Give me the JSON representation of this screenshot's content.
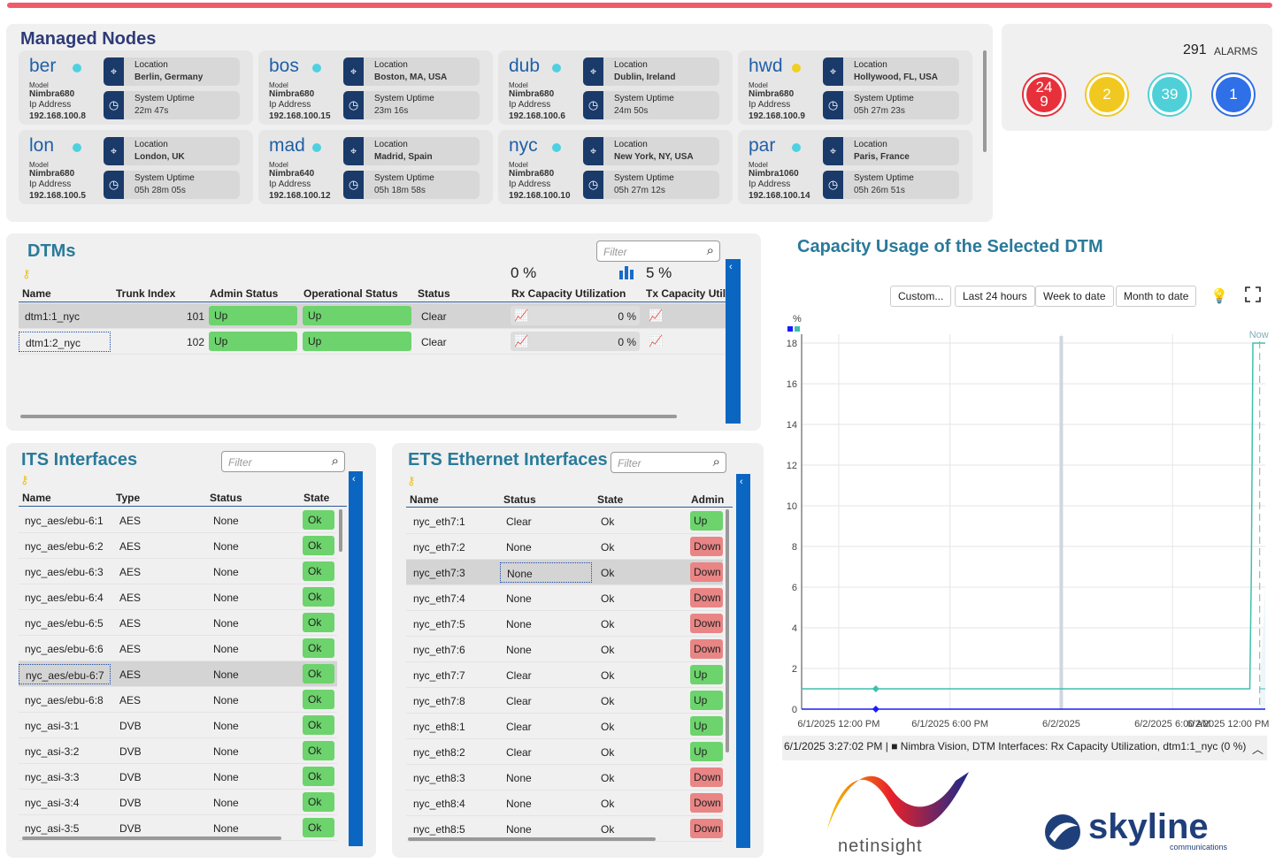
{
  "nodes_panel": {
    "title": "Managed Nodes",
    "nodes": [
      {
        "name": "ber",
        "dot": "#4fd0e0",
        "model_label": "Model",
        "model": "Nimbra680",
        "ip_label": "Ip Address",
        "ip": "192.168.100.8",
        "loc_label": "Location",
        "location": "Berlin, Germany",
        "up_label": "System Uptime",
        "uptime": "22m 47s"
      },
      {
        "name": "bos",
        "dot": "#4fd0e0",
        "model_label": "Model",
        "model": "Nimbra680",
        "ip_label": "Ip Address",
        "ip": "192.168.100.15",
        "loc_label": "Location",
        "location": "Boston, MA, USA",
        "up_label": "System Uptime",
        "uptime": "23m 16s"
      },
      {
        "name": "dub",
        "dot": "#4fd0e0",
        "model_label": "Model",
        "model": "Nimbra680",
        "ip_label": "Ip Address",
        "ip": "192.168.100.6",
        "loc_label": "Location",
        "location": "Dublin, Ireland",
        "up_label": "System Uptime",
        "uptime": "24m 50s"
      },
      {
        "name": "hwd",
        "dot": "#f0d020",
        "model_label": "Model",
        "model": "Nimbra680",
        "ip_label": "Ip Address",
        "ip": "192.168.100.9",
        "loc_label": "Location",
        "location": "Hollywood, FL, USA",
        "up_label": "System Uptime",
        "uptime": "05h 27m 23s"
      },
      {
        "name": "lon",
        "dot": "#4fd0e0",
        "model_label": "Model",
        "model": "Nimbra680",
        "ip_label": "Ip Address",
        "ip": "192.168.100.5",
        "loc_label": "Location",
        "location": "London, UK",
        "up_label": "System Uptime",
        "uptime": "05h 28m 05s"
      },
      {
        "name": "mad",
        "dot": "#4fd0e0",
        "model_label": "Model",
        "model": "Nimbra640",
        "ip_label": "Ip Address",
        "ip": "192.168.100.12",
        "loc_label": "Location",
        "location": "Madrid, Spain",
        "up_label": "System Uptime",
        "uptime": "05h 18m 58s"
      },
      {
        "name": "nyc",
        "dot": "#4fd0e0",
        "model_label": "Model",
        "model": "Nimbra680",
        "ip_label": "Ip Address",
        "ip": "192.168.100.10",
        "loc_label": "Location",
        "location": "New York, NY, USA",
        "up_label": "System Uptime",
        "uptime": "05h 27m 12s"
      },
      {
        "name": "par",
        "dot": "#4fd0e0",
        "model_label": "Model",
        "model": "Nimbra1060",
        "ip_label": "Ip Address",
        "ip": "192.168.100.14",
        "loc_label": "Location",
        "location": "Paris, France",
        "up_label": "System Uptime",
        "uptime": "05h 26m 51s"
      }
    ]
  },
  "alarms": {
    "total": "291",
    "label": "ALARMS",
    "circles": [
      {
        "value": "24\n9",
        "color": "#e8303a",
        "ring": "#e8303a"
      },
      {
        "value": "2",
        "color": "#f0c820",
        "ring": "#f0c820"
      },
      {
        "value": "39",
        "color": "#4fd0d8",
        "ring": "#4fd0d8"
      },
      {
        "value": "1",
        "color": "#2f6fe8",
        "ring": "#2f6fe8"
      }
    ]
  },
  "dtms": {
    "title": "DTMs",
    "filter_placeholder": "Filter",
    "rx_total": "0 %",
    "tx_total": "5 %",
    "columns": [
      "Name",
      "Trunk Index",
      "Admin Status",
      "Operational Status",
      "Status",
      "Rx Capacity Utilization",
      "Tx Capacity Utiliz"
    ],
    "rows": [
      {
        "name": "dtm1:1_nyc",
        "trunk": "101",
        "admin": "Up",
        "oper": "Up",
        "status": "Clear",
        "rx": "0 %"
      },
      {
        "name": "dtm1:2_nyc",
        "trunk": "102",
        "admin": "Up",
        "oper": "Up",
        "status": "Clear",
        "rx": "0 %"
      }
    ]
  },
  "its": {
    "title": "ITS Interfaces",
    "filter_placeholder": "Filter",
    "columns": [
      "Name",
      "Type",
      "Status",
      "State"
    ],
    "rows": [
      [
        "nyc_aes/ebu-6:1",
        "AES",
        "None",
        "Ok"
      ],
      [
        "nyc_aes/ebu-6:2",
        "AES",
        "None",
        "Ok"
      ],
      [
        "nyc_aes/ebu-6:3",
        "AES",
        "None",
        "Ok"
      ],
      [
        "nyc_aes/ebu-6:4",
        "AES",
        "None",
        "Ok"
      ],
      [
        "nyc_aes/ebu-6:5",
        "AES",
        "None",
        "Ok"
      ],
      [
        "nyc_aes/ebu-6:6",
        "AES",
        "None",
        "Ok"
      ],
      [
        "nyc_aes/ebu-6:7",
        "AES",
        "None",
        "Ok"
      ],
      [
        "nyc_aes/ebu-6:8",
        "AES",
        "None",
        "Ok"
      ],
      [
        "nyc_asi-3:1",
        "DVB",
        "None",
        "Ok"
      ],
      [
        "nyc_asi-3:2",
        "DVB",
        "None",
        "Ok"
      ],
      [
        "nyc_asi-3:3",
        "DVB",
        "None",
        "Ok"
      ],
      [
        "nyc_asi-3:4",
        "DVB",
        "None",
        "Ok"
      ],
      [
        "nyc_asi-3:5",
        "DVB",
        "None",
        "Ok"
      ]
    ]
  },
  "ets": {
    "title": "ETS Ethernet Interfaces",
    "filter_placeholder": "Filter",
    "columns": [
      "Name",
      "Status",
      "State",
      "Admin"
    ],
    "rows": [
      [
        "nyc_eth7:1",
        "Clear",
        "Ok",
        "Up"
      ],
      [
        "nyc_eth7:2",
        "None",
        "Ok",
        "Down"
      ],
      [
        "nyc_eth7:3",
        "None",
        "Ok",
        "Down"
      ],
      [
        "nyc_eth7:4",
        "None",
        "Ok",
        "Down"
      ],
      [
        "nyc_eth7:5",
        "None",
        "Ok",
        "Down"
      ],
      [
        "nyc_eth7:6",
        "None",
        "Ok",
        "Down"
      ],
      [
        "nyc_eth7:7",
        "Clear",
        "Ok",
        "Up"
      ],
      [
        "nyc_eth7:8",
        "Clear",
        "Ok",
        "Up"
      ],
      [
        "nyc_eth8:1",
        "Clear",
        "Ok",
        "Up"
      ],
      [
        "nyc_eth8:2",
        "Clear",
        "Ok",
        "Up"
      ],
      [
        "nyc_eth8:3",
        "None",
        "Ok",
        "Down"
      ],
      [
        "nyc_eth8:4",
        "None",
        "Ok",
        "Down"
      ],
      [
        "nyc_eth8:5",
        "None",
        "Ok",
        "Down"
      ]
    ]
  },
  "capacity": {
    "title": "Capacity Usage of the Selected DTM",
    "buttons": [
      "Custom...",
      "Last 24 hours",
      "Week to date",
      "Month to date"
    ],
    "legend": "6/1/2025 3:27:02 PM | ■ Nimbra Vision, DTM Interfaces: Rx Capacity Utilization, dtm1:1_nyc (0 %)",
    "now_label": "Now"
  },
  "chart_data": {
    "type": "line",
    "title": "Capacity Usage of the Selected DTM",
    "ylabel": "%",
    "ylim": [
      0,
      18
    ],
    "yticks": [
      0,
      2,
      4,
      6,
      8,
      10,
      12,
      14,
      16,
      18
    ],
    "xticks": [
      "6/1/2025 12:00 PM",
      "6/1/2025 6:00 PM",
      "6/2/2025",
      "6/2/2025 6:00 AM",
      "6/2/2025 12:00 PM"
    ],
    "series": [
      {
        "color": "#3fbfae",
        "points": [
          [
            "6/1/2025 10:00 AM",
            1
          ],
          [
            "6/2/2025 10:10 AM",
            1
          ],
          [
            "6/2/2025 10:15 AM",
            6.8
          ],
          [
            "6/2/2025 10:20 AM",
            18
          ],
          [
            "6/2/2025 11:00 AM",
            18
          ]
        ]
      },
      {
        "color": "#1a1aff",
        "points": [
          [
            "6/1/2025 10:00 AM",
            0
          ],
          [
            "6/2/2025 11:00 AM",
            0
          ]
        ]
      }
    ]
  },
  "logos": {
    "netinsight": "netinsight",
    "skyline": "skyline",
    "skyline_sub": "communications"
  }
}
